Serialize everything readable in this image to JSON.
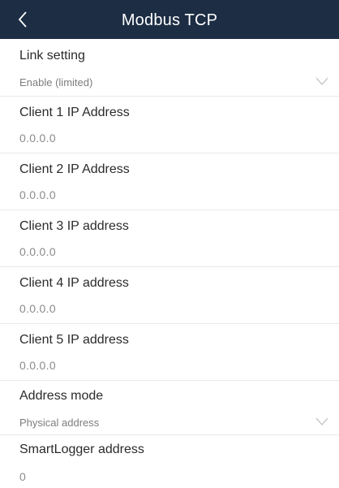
{
  "header": {
    "title": "Modbus TCP",
    "back_icon": "chevron-left-icon"
  },
  "colors": {
    "header_bg": "#1c2d44",
    "header_text": "#ffffff",
    "label_text": "#2b2b2b",
    "value_text": "#7d7d7d"
  },
  "settings": {
    "link_setting": {
      "label": "Link setting",
      "value": "Enable (limited)",
      "icon": "chevron-down-icon"
    },
    "clients": [
      {
        "label": "Client 1 IP Address",
        "value": "0.0.0.0"
      },
      {
        "label": "Client 2 IP Address",
        "value": "0.0.0.0"
      },
      {
        "label": "Client 3 IP address",
        "value": "0.0.0.0"
      },
      {
        "label": "Client 4 IP address",
        "value": "0.0.0.0"
      },
      {
        "label": "Client 5 IP address",
        "value": "0.0.0.0"
      }
    ],
    "address_mode": {
      "label": "Address mode",
      "value": "Physical address",
      "icon": "chevron-down-icon"
    },
    "smartlogger_address": {
      "label": "SmartLogger address",
      "value": "0"
    }
  }
}
